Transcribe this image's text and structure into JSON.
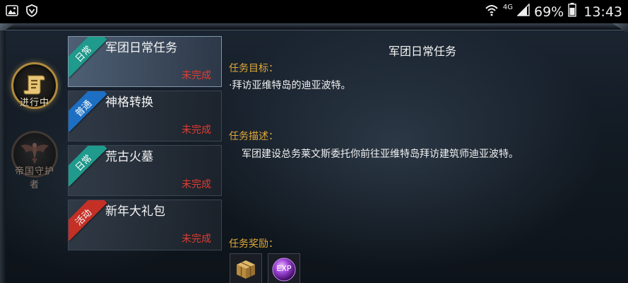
{
  "status_bar": {
    "network": "4G",
    "battery_percent": "69%",
    "time": "13:43",
    "icons": [
      "image-icon",
      "shield-app-icon",
      "wifi-icon",
      "signal-icon",
      "battery-icon"
    ]
  },
  "sidebar": {
    "emblems": [
      {
        "label": "进行中",
        "state": "active",
        "icon": "scroll-emblem-icon"
      },
      {
        "label": "帝国守护者",
        "state": "idle",
        "icon": "eagle-emblem-icon"
      }
    ]
  },
  "quests": [
    {
      "tag": "日常",
      "tag_color": "#1f9a8c",
      "name": "军团日常任务",
      "status": "未完成",
      "selected": true
    },
    {
      "tag": "普通",
      "tag_color": "#1d6fc4",
      "name": "神格转换",
      "status": "未完成",
      "selected": false
    },
    {
      "tag": "日常",
      "tag_color": "#1f9a8c",
      "name": "荒古火墓",
      "status": "未完成",
      "selected": false
    },
    {
      "tag": "活动",
      "tag_color": "#c43026",
      "name": "新年大礼包",
      "status": "未完成",
      "selected": false
    }
  ],
  "detail": {
    "title": "军团日常任务",
    "goal_heading": "任务目标：",
    "goal_text": "·拜访亚维特岛的迪亚波特。",
    "desc_heading": "任务描述：",
    "desc_text": "军团建设总务莱文斯委托你前往亚维特岛拜访建筑师迪亚波特。",
    "reward_heading": "任务奖励：",
    "rewards": [
      {
        "icon": "treasure-crate-icon"
      },
      {
        "icon": "exp-orb-icon",
        "label": "EXP"
      }
    ]
  },
  "colors": {
    "heading": "#e0a93a",
    "status_incomplete": "#e03c32",
    "emblem_gold": "#b08a3e"
  }
}
